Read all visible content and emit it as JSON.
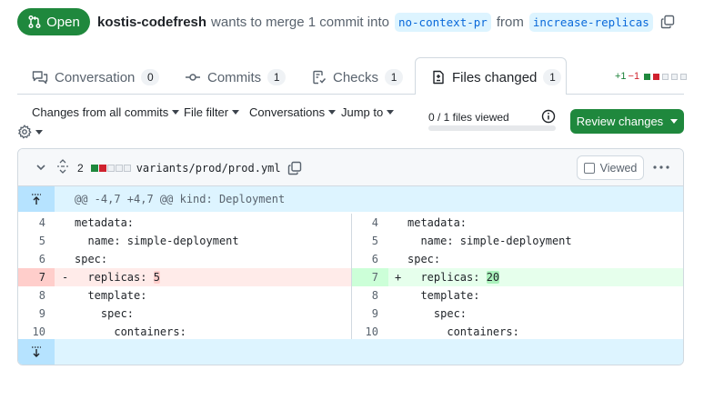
{
  "header": {
    "status": "Open",
    "author": "kostis-codefresh",
    "merge_text": "wants to merge 1 commit into",
    "base_branch": "no-context-pr",
    "from_text": "from",
    "head_branch": "increase-replicas"
  },
  "tabs": [
    {
      "label": "Conversation",
      "count": "0"
    },
    {
      "label": "Commits",
      "count": "1"
    },
    {
      "label": "Checks",
      "count": "1"
    },
    {
      "label": "Files changed",
      "count": "1"
    }
  ],
  "diffstat": {
    "additions": "+1",
    "deletions": "−1"
  },
  "toolbar": {
    "changes_from": "Changes from all commits",
    "file_filter": "File filter",
    "conversations": "Conversations",
    "jump_to": "Jump to",
    "files_viewed": "0 / 1 files viewed",
    "files_viewed_progress": 0,
    "review_button": "Review changes"
  },
  "file": {
    "changes": "2",
    "path": "variants/prod/prod.yml",
    "viewed_label": "Viewed",
    "hunk_header": "@@ -4,7 +4,7 @@ kind: Deployment"
  },
  "diff": {
    "rows": [
      {
        "lnum": "4",
        "ltext": "metadata:",
        "rnum": "4",
        "rtext": "metadata:"
      },
      {
        "lnum": "5",
        "ltext": "  name: simple-deployment",
        "rnum": "5",
        "rtext": "  name: simple-deployment"
      },
      {
        "lnum": "6",
        "ltext": "spec:",
        "rnum": "6",
        "rtext": "spec:"
      },
      {
        "lnum": "7",
        "lsign": "-",
        "lprefix": "  replicas: ",
        "lvalue": "5",
        "rnum": "7",
        "rsign": "+",
        "rprefix": "  replicas: ",
        "rvalue": "20"
      },
      {
        "lnum": "8",
        "ltext": "  template:",
        "rnum": "8",
        "rtext": "  template:"
      },
      {
        "lnum": "9",
        "ltext": "    spec:",
        "rnum": "9",
        "rtext": "    spec:"
      },
      {
        "lnum": "10",
        "ltext": "      containers:",
        "rnum": "10",
        "rtext": "      containers:"
      }
    ]
  },
  "colors": {
    "open_green": "#1f883d",
    "link_blue": "#0969da",
    "del_bg": "#ffebe9",
    "add_bg": "#e6ffec",
    "hunk_bg": "#ddf4ff"
  }
}
